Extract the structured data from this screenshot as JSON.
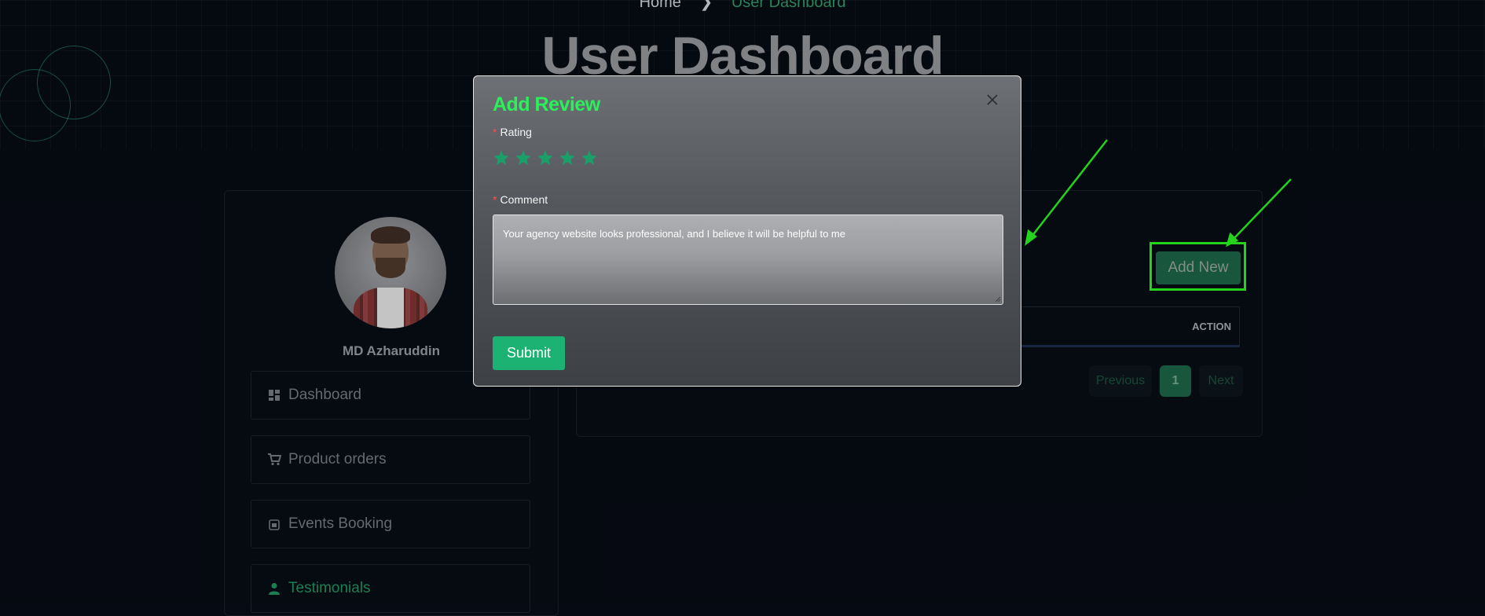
{
  "header": {
    "breadcrumb_home": "Home",
    "breadcrumb_current": "User Dashboard",
    "title": "User Dashboard"
  },
  "sidebar": {
    "user_name": "MD Azharuddin",
    "items": [
      {
        "label": "Dashboard",
        "icon": "dashboard-icon"
      },
      {
        "label": "Product orders",
        "icon": "cart-icon"
      },
      {
        "label": "Events Booking",
        "icon": "calendar-icon"
      },
      {
        "label": "Testimonials",
        "icon": "user-icon"
      }
    ]
  },
  "main": {
    "add_new_label": "Add New",
    "table_action_header": "ACTION",
    "pagination": {
      "previous": "Previous",
      "page": "1",
      "next": "Next"
    }
  },
  "modal": {
    "title": "Add Review",
    "rating_label": "Rating",
    "rating_value": 5,
    "rating_max": 5,
    "comment_label": "Comment",
    "comment_value": "Your agency website looks professional, and I believe it will be helpful to me",
    "required_mark": "*",
    "submit_label": "Submit"
  },
  "colors": {
    "accent_green": "#2af05a",
    "button_green": "#1bb274",
    "annotation_green": "#27e51f",
    "star_green": "#1a9e6a"
  }
}
